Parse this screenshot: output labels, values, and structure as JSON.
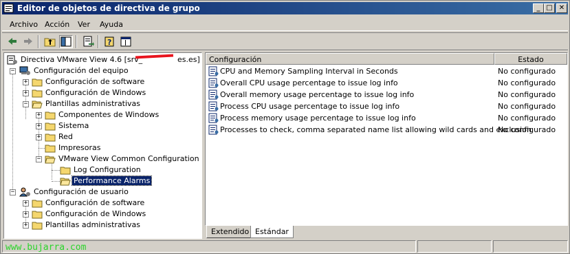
{
  "window": {
    "title": "Editor de objetos de directiva de grupo",
    "controls": {
      "minimize": "_",
      "maximize": "□",
      "close": "✕"
    }
  },
  "menubar": {
    "items": [
      "Archivo",
      "Acción",
      "Ver",
      "Ayuda"
    ]
  },
  "toolbar": {
    "icons": [
      "back-arrow-icon",
      "forward-arrow-icon",
      "up-folder-icon",
      "show-hide-tree-icon",
      "export-list-icon",
      "help-icon",
      "properties-icon"
    ]
  },
  "tree": {
    "root": "Directiva VMware View 4.6 [srv_",
    "root_suffix": "es.es]",
    "computer_config": "Configuración del equipo",
    "software_settings": "Configuración de software",
    "windows_settings": "Configuración de Windows",
    "admin_templates": "Plantillas administrativas",
    "windows_components": "Componentes de Windows",
    "system": "Sistema",
    "network": "Red",
    "printers": "Impresoras",
    "vmware_common": "VMware View Common Configuration",
    "log_config": "Log Configuration",
    "perf_alarms": "Performance Alarms",
    "user_config": "Configuración de usuario",
    "user_software_settings": "Configuración de software",
    "user_windows_settings": "Configuración de Windows",
    "user_admin_templates": "Plantillas administrativas"
  },
  "list": {
    "headers": {
      "setting": "Configuración",
      "state": "Estado"
    },
    "rows": [
      {
        "name": "CPU and Memory Sampling Interval in Seconds",
        "state": "No configurado"
      },
      {
        "name": "Overall CPU usage percentage to issue log info",
        "state": "No configurado"
      },
      {
        "name": "Overall memory usage percentage to issue log info",
        "state": "No configurado"
      },
      {
        "name": "Process CPU usage percentage to issue log info",
        "state": "No configurado"
      },
      {
        "name": "Process memory usage percentage to issue log info",
        "state": "No configurado"
      },
      {
        "name": "Processes to check, comma separated name list allowing wild cards and exclusion",
        "state": "No configurado"
      }
    ]
  },
  "tabs": {
    "extended": "Extendido",
    "standard": "Estándar",
    "active": "Estándar"
  },
  "statusbar": {
    "watermark": "www.bujarra.com"
  },
  "colors": {
    "title_start": "#0a246a",
    "title_end": "#3a6ea5",
    "selection": "#0a246a",
    "watermark": "#2bd42b",
    "redaction": "#e8141d"
  }
}
